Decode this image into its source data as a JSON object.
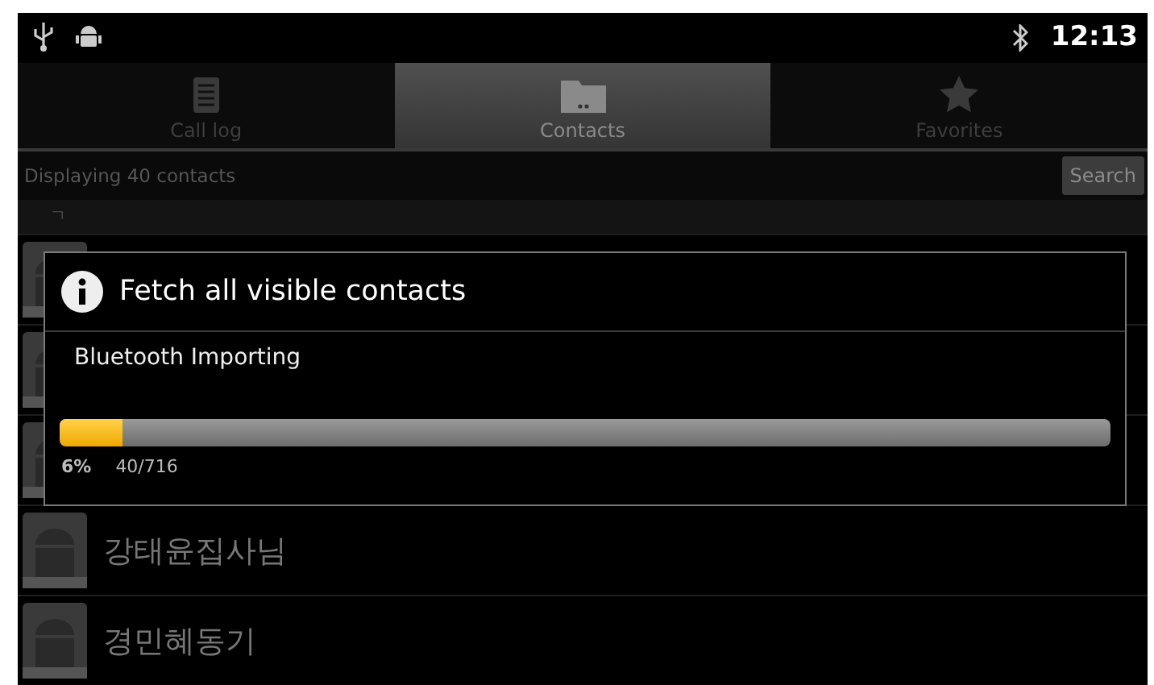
{
  "status_bar": {
    "time": "12:13"
  },
  "tabs": [
    {
      "label": "Call log",
      "selected": false,
      "kind": "list"
    },
    {
      "label": "Contacts",
      "selected": true,
      "kind": "folder"
    },
    {
      "label": "Favorites",
      "selected": false,
      "kind": "star"
    }
  ],
  "info_bar": {
    "text": "Displaying 40 contacts",
    "button": "Search"
  },
  "section_header": "ㄱ",
  "contacts": [
    {
      "kind": "covered"
    },
    {
      "kind": "covered"
    },
    {
      "kind": "covered"
    },
    {
      "kind": "contact",
      "name": "강태윤집사님"
    },
    {
      "kind": "contact",
      "name": "경민혜동기"
    }
  ],
  "dialog": {
    "title": "Fetch all visible contacts",
    "message": "Bluetooth Importing",
    "level": 0.06,
    "percent": "6%",
    "count": "40/716"
  }
}
